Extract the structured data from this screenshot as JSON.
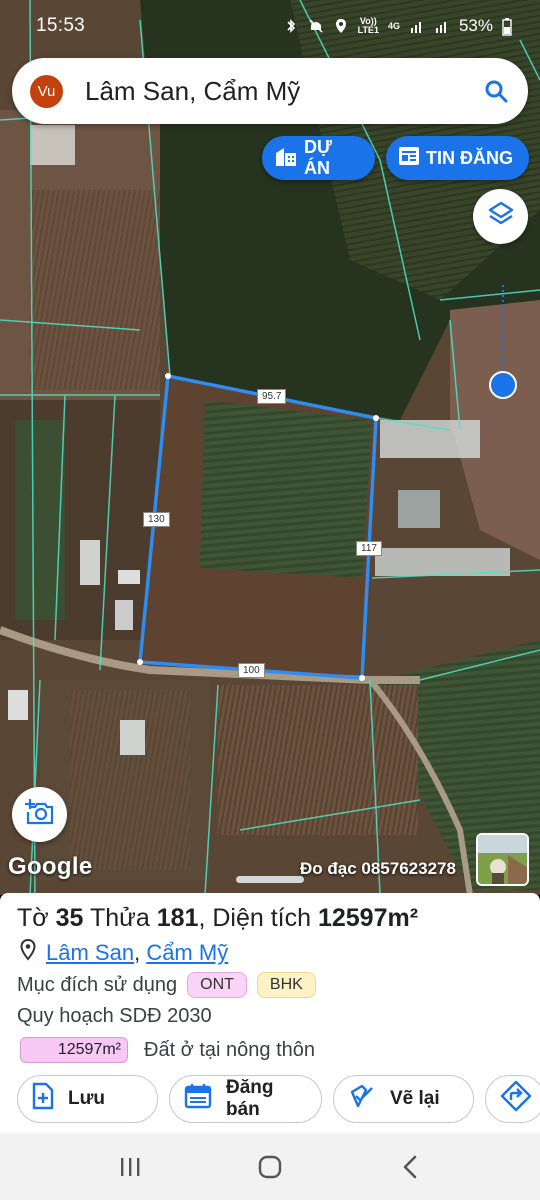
{
  "status_bar": {
    "time": "15:53",
    "battery": "53%",
    "network_top": "Vo))",
    "network_bottom": "LTE1",
    "data_type": "4G"
  },
  "search": {
    "avatar_initials": "Vu",
    "query": "Lâm San, Cẩm Mỹ"
  },
  "map_buttons": {
    "projects_label": "DỰ ÁN",
    "listings_label": "TIN ĐĂNG"
  },
  "parcel_edges": {
    "top": "95.7",
    "left": "130",
    "right": "117",
    "bottom": "100"
  },
  "map_footer": {
    "google": "Google",
    "survey": "Đo đạc 0857623278"
  },
  "parcel": {
    "title_prefix": "Tờ",
    "sheet_no": "35",
    "plot_label": "Thửa",
    "plot_no": "181",
    "area_label": "Diện tích",
    "area_value": "12597m²",
    "commune": "Lâm San",
    "district": "Cẩm Mỹ",
    "separator": ",",
    "purpose_label": "Mục đích sử dụng",
    "purpose_tags": [
      "ONT",
      "BHK"
    ],
    "plan_label": "Quy hoạch SDĐ 2030",
    "plan_area": "12597m²",
    "plan_desc": "Đất ở tại nông thôn"
  },
  "actions": {
    "save": "Lưu",
    "sell": "Đăng bán",
    "redraw": "Vẽ lại"
  },
  "colors": {
    "accent": "#1a73e8",
    "avatar": "#c2410c",
    "tag_ont": "#f9d4f6",
    "tag_bhk": "#fdf2c4",
    "parcel_outline": "#2f8cf0",
    "boundary_lines": "#4fe3c8"
  }
}
